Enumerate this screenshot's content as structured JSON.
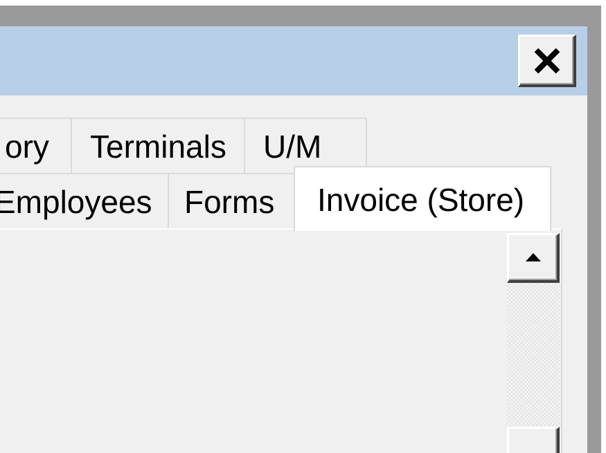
{
  "window": {
    "close_icon": "close-icon"
  },
  "tabs": {
    "row1": [
      {
        "label": "ory"
      },
      {
        "label": "Terminals"
      },
      {
        "label": "U/M"
      }
    ],
    "row2": [
      {
        "label": "Employees"
      },
      {
        "label": "Forms"
      },
      {
        "label": "Invoice (Store)",
        "active": true
      }
    ]
  },
  "scrollbar": {
    "up_icon": "arrow-up-icon"
  }
}
